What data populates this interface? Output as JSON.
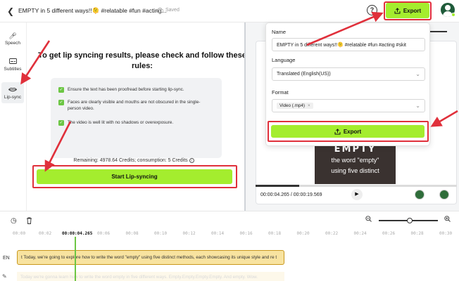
{
  "topbar": {
    "title": "EMPTY in 5 different ways!!🫠 #relatable #fun #acting...",
    "saved": "Saved",
    "export_label": "Export"
  },
  "sidebar": {
    "items": [
      {
        "label": "Speech",
        "icon": "mic-icon"
      },
      {
        "label": "Subtitles",
        "icon": "subtitles-icon"
      },
      {
        "label": "Lip-sync",
        "icon": "lips-icon",
        "active": true
      }
    ]
  },
  "rules": {
    "heading": "To get lip syncing results, please check and follow these rules:",
    "items": [
      "Ensure the text has been proofread before starting lip-sync.",
      "Faces are clearly visible and mouths are not obscured in the single-person video.",
      "The video is well lit with no shadows or overexposure."
    ],
    "credits": "Remaining: 4978.64 Credits; consumption: 5 Credits",
    "start_button": "Start Lip-syncing"
  },
  "export_popup": {
    "name_label": "Name",
    "name_value": "EMPTY in 5 different ways!!🫠 #relatable #fun #acting #skit",
    "language_label": "Language",
    "language_value": "Translated (English(US))",
    "format_label": "Format",
    "format_value": "Video (.mp4)",
    "export_label": "Export"
  },
  "preview": {
    "video_text": [
      "EMPTY",
      "the word \"empty\"",
      "using five distinct"
    ],
    "current_time": "00:00:04.265",
    "total_time": "00:00:19.569",
    "time_display": "00:00:04.265 / 00:00:19.569",
    "progress": 0.218
  },
  "timeline": {
    "ticks": [
      "00:00",
      "00:02",
      "00:00:04.265",
      "00:06",
      "00:08",
      "00:10",
      "00:12",
      "00:14",
      "00:16",
      "00:18",
      "00:20",
      "00:22",
      "00:24",
      "00:26",
      "00:28",
      "00:30"
    ],
    "zoom_level": 0.52,
    "lang_label": "EN",
    "track1_text": "t Today, we're going to explore how to write the word \"empty\" using five distinct methods, each showcasing its unique style and re t",
    "track2_text": "Today we're gonna learn how to write the word empty in five different ways. Empty.Empty.Empty.Empty. And empty. Wow."
  },
  "colors": {
    "accent": "#a4ed2e",
    "highlight_red": "#e0303b",
    "check_green": "#6cc644",
    "track_fill": "#f8e3a0"
  }
}
